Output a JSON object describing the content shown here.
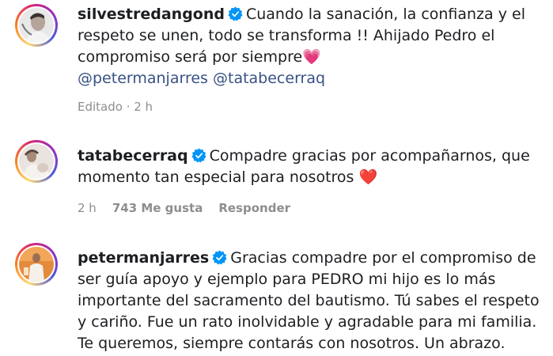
{
  "comments": [
    {
      "username": "silvestredangond",
      "text_before_heart": "Cuando la sanación, la confianza y el respeto se unen, todo se transforma !! Ahijado Pedro el compromiso será por siempre",
      "heart": "💗",
      "mentions": [
        "@petermanjarres",
        "@tatabecerraq"
      ],
      "meta_time": "Editado · 2 h"
    },
    {
      "username": "tatabecerraq",
      "text_before_heart": "Compadre gracias por acompañarnos, que momento tan especial para nosotros",
      "heart": "❤️",
      "meta_time": "2 h",
      "likes": "743 Me gusta",
      "reply": "Responder"
    },
    {
      "username": "petermanjarres",
      "text": "Gracias compadre por el compromiso de ser guía apoyo y ejemplo para PEDRO mi hijo es lo más importante del sacramento del bautismo. Tú sabes el respeto y cariño. Fue un rato inolvidable y agradable para mi familia. Te queremos, siempre contarás con nosotros. Un abrazo."
    }
  ],
  "colors": {
    "verified": "#0095f6",
    "mention": "#385185",
    "meta": "#8e8e8e"
  },
  "icons": {
    "verified": "verified-badge-icon"
  }
}
